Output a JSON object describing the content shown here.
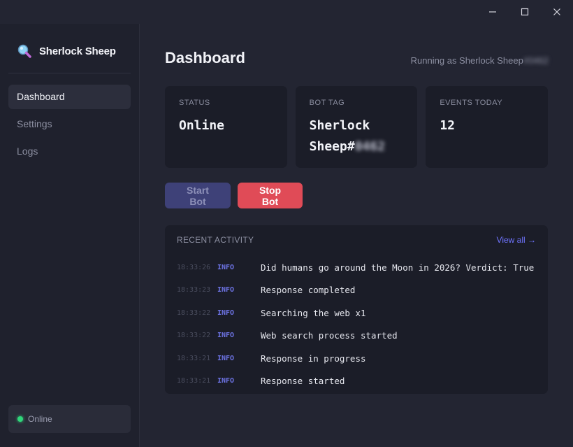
{
  "window": {
    "minimize_glyph": "—",
    "maximize_glyph": "☐",
    "close_glyph": "✕"
  },
  "sidebar": {
    "brand": "Sherlock Sheep",
    "nav": [
      {
        "label": "Dashboard",
        "active": true
      },
      {
        "label": "Settings",
        "active": false
      },
      {
        "label": "Logs",
        "active": false
      }
    ],
    "status": "Online"
  },
  "header": {
    "title": "Dashboard",
    "running_as_prefix": "Running as Sherlock Sheep",
    "running_as_redacted": "#0462"
  },
  "cards": [
    {
      "label": "Status",
      "value": "Online"
    },
    {
      "label": "Bot Tag",
      "value": "Sherlock Sheep#",
      "redacted": "0462"
    },
    {
      "label": "Events Today",
      "value": "12"
    }
  ],
  "buttons": {
    "start": "Start Bot",
    "stop": "Stop Bot"
  },
  "activity": {
    "title": "Recent Activity",
    "view_all": "View all →",
    "logs": [
      {
        "time": "18:33:26",
        "level": "INFO",
        "message": "Did humans go around the Moon in 2026? Verdict: True"
      },
      {
        "time": "18:33:23",
        "level": "INFO",
        "message": "Response completed"
      },
      {
        "time": "18:33:22",
        "level": "INFO",
        "message": "Searching the web x1"
      },
      {
        "time": "18:33:22",
        "level": "INFO",
        "message": "Web search process started"
      },
      {
        "time": "18:33:21",
        "level": "INFO",
        "message": "Response in progress"
      },
      {
        "time": "18:33:21",
        "level": "INFO",
        "message": "Response started"
      }
    ]
  },
  "colors": {
    "accent": "#6f74ff",
    "danger": "#e04b57",
    "online": "#30d67a"
  }
}
